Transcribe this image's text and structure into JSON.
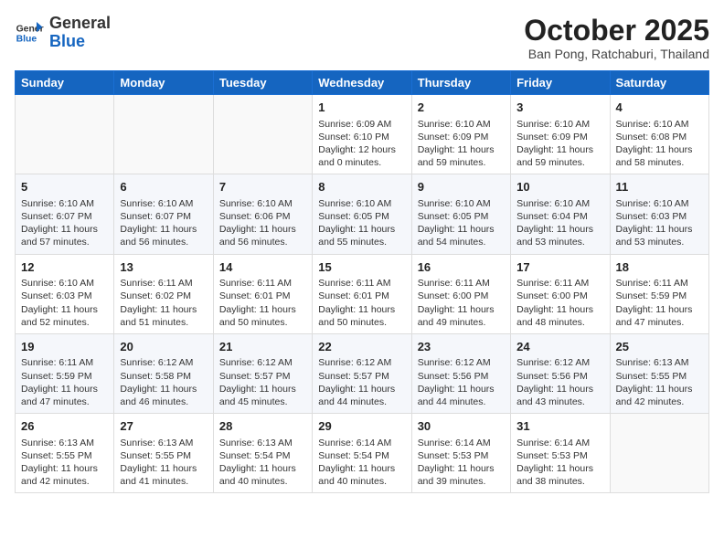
{
  "header": {
    "logo_general": "General",
    "logo_blue": "Blue",
    "month_title": "October 2025",
    "location": "Ban Pong, Ratchaburi, Thailand"
  },
  "weekdays": [
    "Sunday",
    "Monday",
    "Tuesday",
    "Wednesday",
    "Thursday",
    "Friday",
    "Saturday"
  ],
  "weeks": [
    [
      {
        "day": "",
        "info": ""
      },
      {
        "day": "",
        "info": ""
      },
      {
        "day": "",
        "info": ""
      },
      {
        "day": "1",
        "info": "Sunrise: 6:09 AM\nSunset: 6:10 PM\nDaylight: 12 hours\nand 0 minutes."
      },
      {
        "day": "2",
        "info": "Sunrise: 6:10 AM\nSunset: 6:09 PM\nDaylight: 11 hours\nand 59 minutes."
      },
      {
        "day": "3",
        "info": "Sunrise: 6:10 AM\nSunset: 6:09 PM\nDaylight: 11 hours\nand 59 minutes."
      },
      {
        "day": "4",
        "info": "Sunrise: 6:10 AM\nSunset: 6:08 PM\nDaylight: 11 hours\nand 58 minutes."
      }
    ],
    [
      {
        "day": "5",
        "info": "Sunrise: 6:10 AM\nSunset: 6:07 PM\nDaylight: 11 hours\nand 57 minutes."
      },
      {
        "day": "6",
        "info": "Sunrise: 6:10 AM\nSunset: 6:07 PM\nDaylight: 11 hours\nand 56 minutes."
      },
      {
        "day": "7",
        "info": "Sunrise: 6:10 AM\nSunset: 6:06 PM\nDaylight: 11 hours\nand 56 minutes."
      },
      {
        "day": "8",
        "info": "Sunrise: 6:10 AM\nSunset: 6:05 PM\nDaylight: 11 hours\nand 55 minutes."
      },
      {
        "day": "9",
        "info": "Sunrise: 6:10 AM\nSunset: 6:05 PM\nDaylight: 11 hours\nand 54 minutes."
      },
      {
        "day": "10",
        "info": "Sunrise: 6:10 AM\nSunset: 6:04 PM\nDaylight: 11 hours\nand 53 minutes."
      },
      {
        "day": "11",
        "info": "Sunrise: 6:10 AM\nSunset: 6:03 PM\nDaylight: 11 hours\nand 53 minutes."
      }
    ],
    [
      {
        "day": "12",
        "info": "Sunrise: 6:10 AM\nSunset: 6:03 PM\nDaylight: 11 hours\nand 52 minutes."
      },
      {
        "day": "13",
        "info": "Sunrise: 6:11 AM\nSunset: 6:02 PM\nDaylight: 11 hours\nand 51 minutes."
      },
      {
        "day": "14",
        "info": "Sunrise: 6:11 AM\nSunset: 6:01 PM\nDaylight: 11 hours\nand 50 minutes."
      },
      {
        "day": "15",
        "info": "Sunrise: 6:11 AM\nSunset: 6:01 PM\nDaylight: 11 hours\nand 50 minutes."
      },
      {
        "day": "16",
        "info": "Sunrise: 6:11 AM\nSunset: 6:00 PM\nDaylight: 11 hours\nand 49 minutes."
      },
      {
        "day": "17",
        "info": "Sunrise: 6:11 AM\nSunset: 6:00 PM\nDaylight: 11 hours\nand 48 minutes."
      },
      {
        "day": "18",
        "info": "Sunrise: 6:11 AM\nSunset: 5:59 PM\nDaylight: 11 hours\nand 47 minutes."
      }
    ],
    [
      {
        "day": "19",
        "info": "Sunrise: 6:11 AM\nSunset: 5:59 PM\nDaylight: 11 hours\nand 47 minutes."
      },
      {
        "day": "20",
        "info": "Sunrise: 6:12 AM\nSunset: 5:58 PM\nDaylight: 11 hours\nand 46 minutes."
      },
      {
        "day": "21",
        "info": "Sunrise: 6:12 AM\nSunset: 5:57 PM\nDaylight: 11 hours\nand 45 minutes."
      },
      {
        "day": "22",
        "info": "Sunrise: 6:12 AM\nSunset: 5:57 PM\nDaylight: 11 hours\nand 44 minutes."
      },
      {
        "day": "23",
        "info": "Sunrise: 6:12 AM\nSunset: 5:56 PM\nDaylight: 11 hours\nand 44 minutes."
      },
      {
        "day": "24",
        "info": "Sunrise: 6:12 AM\nSunset: 5:56 PM\nDaylight: 11 hours\nand 43 minutes."
      },
      {
        "day": "25",
        "info": "Sunrise: 6:13 AM\nSunset: 5:55 PM\nDaylight: 11 hours\nand 42 minutes."
      }
    ],
    [
      {
        "day": "26",
        "info": "Sunrise: 6:13 AM\nSunset: 5:55 PM\nDaylight: 11 hours\nand 42 minutes."
      },
      {
        "day": "27",
        "info": "Sunrise: 6:13 AM\nSunset: 5:55 PM\nDaylight: 11 hours\nand 41 minutes."
      },
      {
        "day": "28",
        "info": "Sunrise: 6:13 AM\nSunset: 5:54 PM\nDaylight: 11 hours\nand 40 minutes."
      },
      {
        "day": "29",
        "info": "Sunrise: 6:14 AM\nSunset: 5:54 PM\nDaylight: 11 hours\nand 40 minutes."
      },
      {
        "day": "30",
        "info": "Sunrise: 6:14 AM\nSunset: 5:53 PM\nDaylight: 11 hours\nand 39 minutes."
      },
      {
        "day": "31",
        "info": "Sunrise: 6:14 AM\nSunset: 5:53 PM\nDaylight: 11 hours\nand 38 minutes."
      },
      {
        "day": "",
        "info": ""
      }
    ]
  ]
}
